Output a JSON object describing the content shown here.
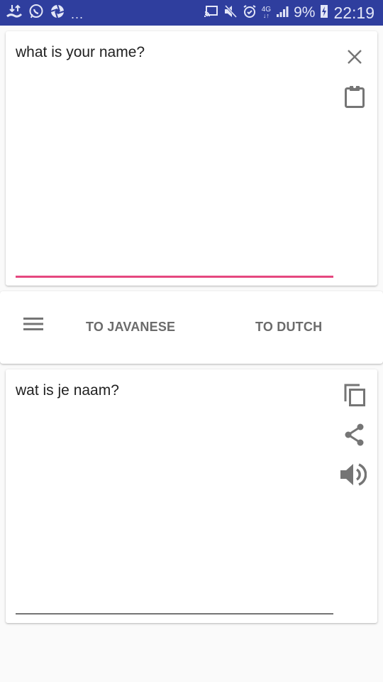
{
  "status_bar": {
    "left_icons": [
      "download-upload-icon",
      "whatsapp-icon",
      "aperture-icon"
    ],
    "overflow": "...",
    "right_icons": [
      "cast-icon",
      "mute-icon",
      "alarm-icon",
      "4g-icon",
      "signal-icon"
    ],
    "network": "4G",
    "battery": "9%",
    "time": "22:19"
  },
  "input_card": {
    "text": "what is your name?",
    "accent_color": "#e5487f",
    "actions": [
      "clear-icon",
      "paste-icon"
    ]
  },
  "toolbar": {
    "menu_icon": "menu-icon",
    "tabs": [
      {
        "label": "TO JAVANESE"
      },
      {
        "label": "TO DUTCH"
      }
    ]
  },
  "output_card": {
    "text": "wat is je naam?",
    "actions": [
      "copy-icon",
      "share-icon",
      "speaker-icon"
    ]
  }
}
